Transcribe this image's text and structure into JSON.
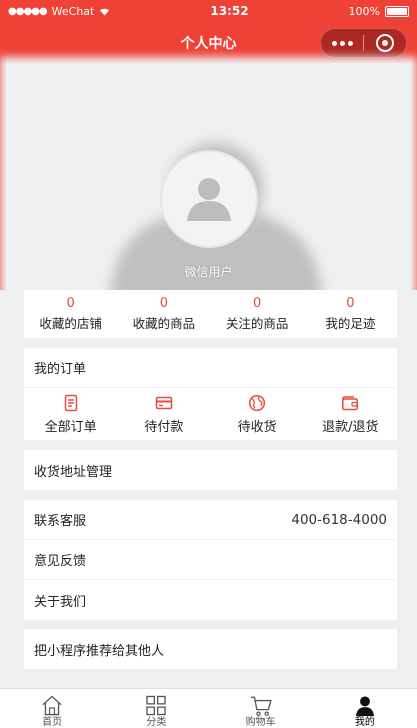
{
  "status_bar": {
    "signal": "●●●●●",
    "carrier": "WeChat",
    "time": "13:52",
    "battery": "100%"
  },
  "navbar": {
    "title": "个人中心"
  },
  "profile": {
    "nickname": "微信用户"
  },
  "stats": [
    {
      "count": "0",
      "label": "收藏的店铺"
    },
    {
      "count": "0",
      "label": "收藏的商品"
    },
    {
      "count": "0",
      "label": "关注的商品"
    },
    {
      "count": "0",
      "label": "我的足迹"
    }
  ],
  "orders": {
    "title": "我的订单",
    "items": [
      {
        "label": "全部订单",
        "icon": "order-list-icon"
      },
      {
        "label": "待付款",
        "icon": "card-icon"
      },
      {
        "label": "待收货",
        "icon": "globe-icon"
      },
      {
        "label": "退款/退货",
        "icon": "wallet-icon"
      }
    ]
  },
  "address": {
    "label": "收货地址管理"
  },
  "service": {
    "contact_label": "联系客服",
    "contact_phone": "400-618-4000",
    "feedback_label": "意见反馈",
    "about_label": "关于我们"
  },
  "share": {
    "label": "把小程序推荐给其他人"
  },
  "tabbar": [
    {
      "label": "首页",
      "icon": "home-icon"
    },
    {
      "label": "分类",
      "icon": "category-grid-icon"
    },
    {
      "label": "购物车",
      "icon": "cart-icon"
    },
    {
      "label": "我的",
      "icon": "user-icon",
      "active": true
    }
  ],
  "colors": {
    "brand": "#ef4136",
    "accent_text": "#e94a3d",
    "background": "#efefef"
  }
}
